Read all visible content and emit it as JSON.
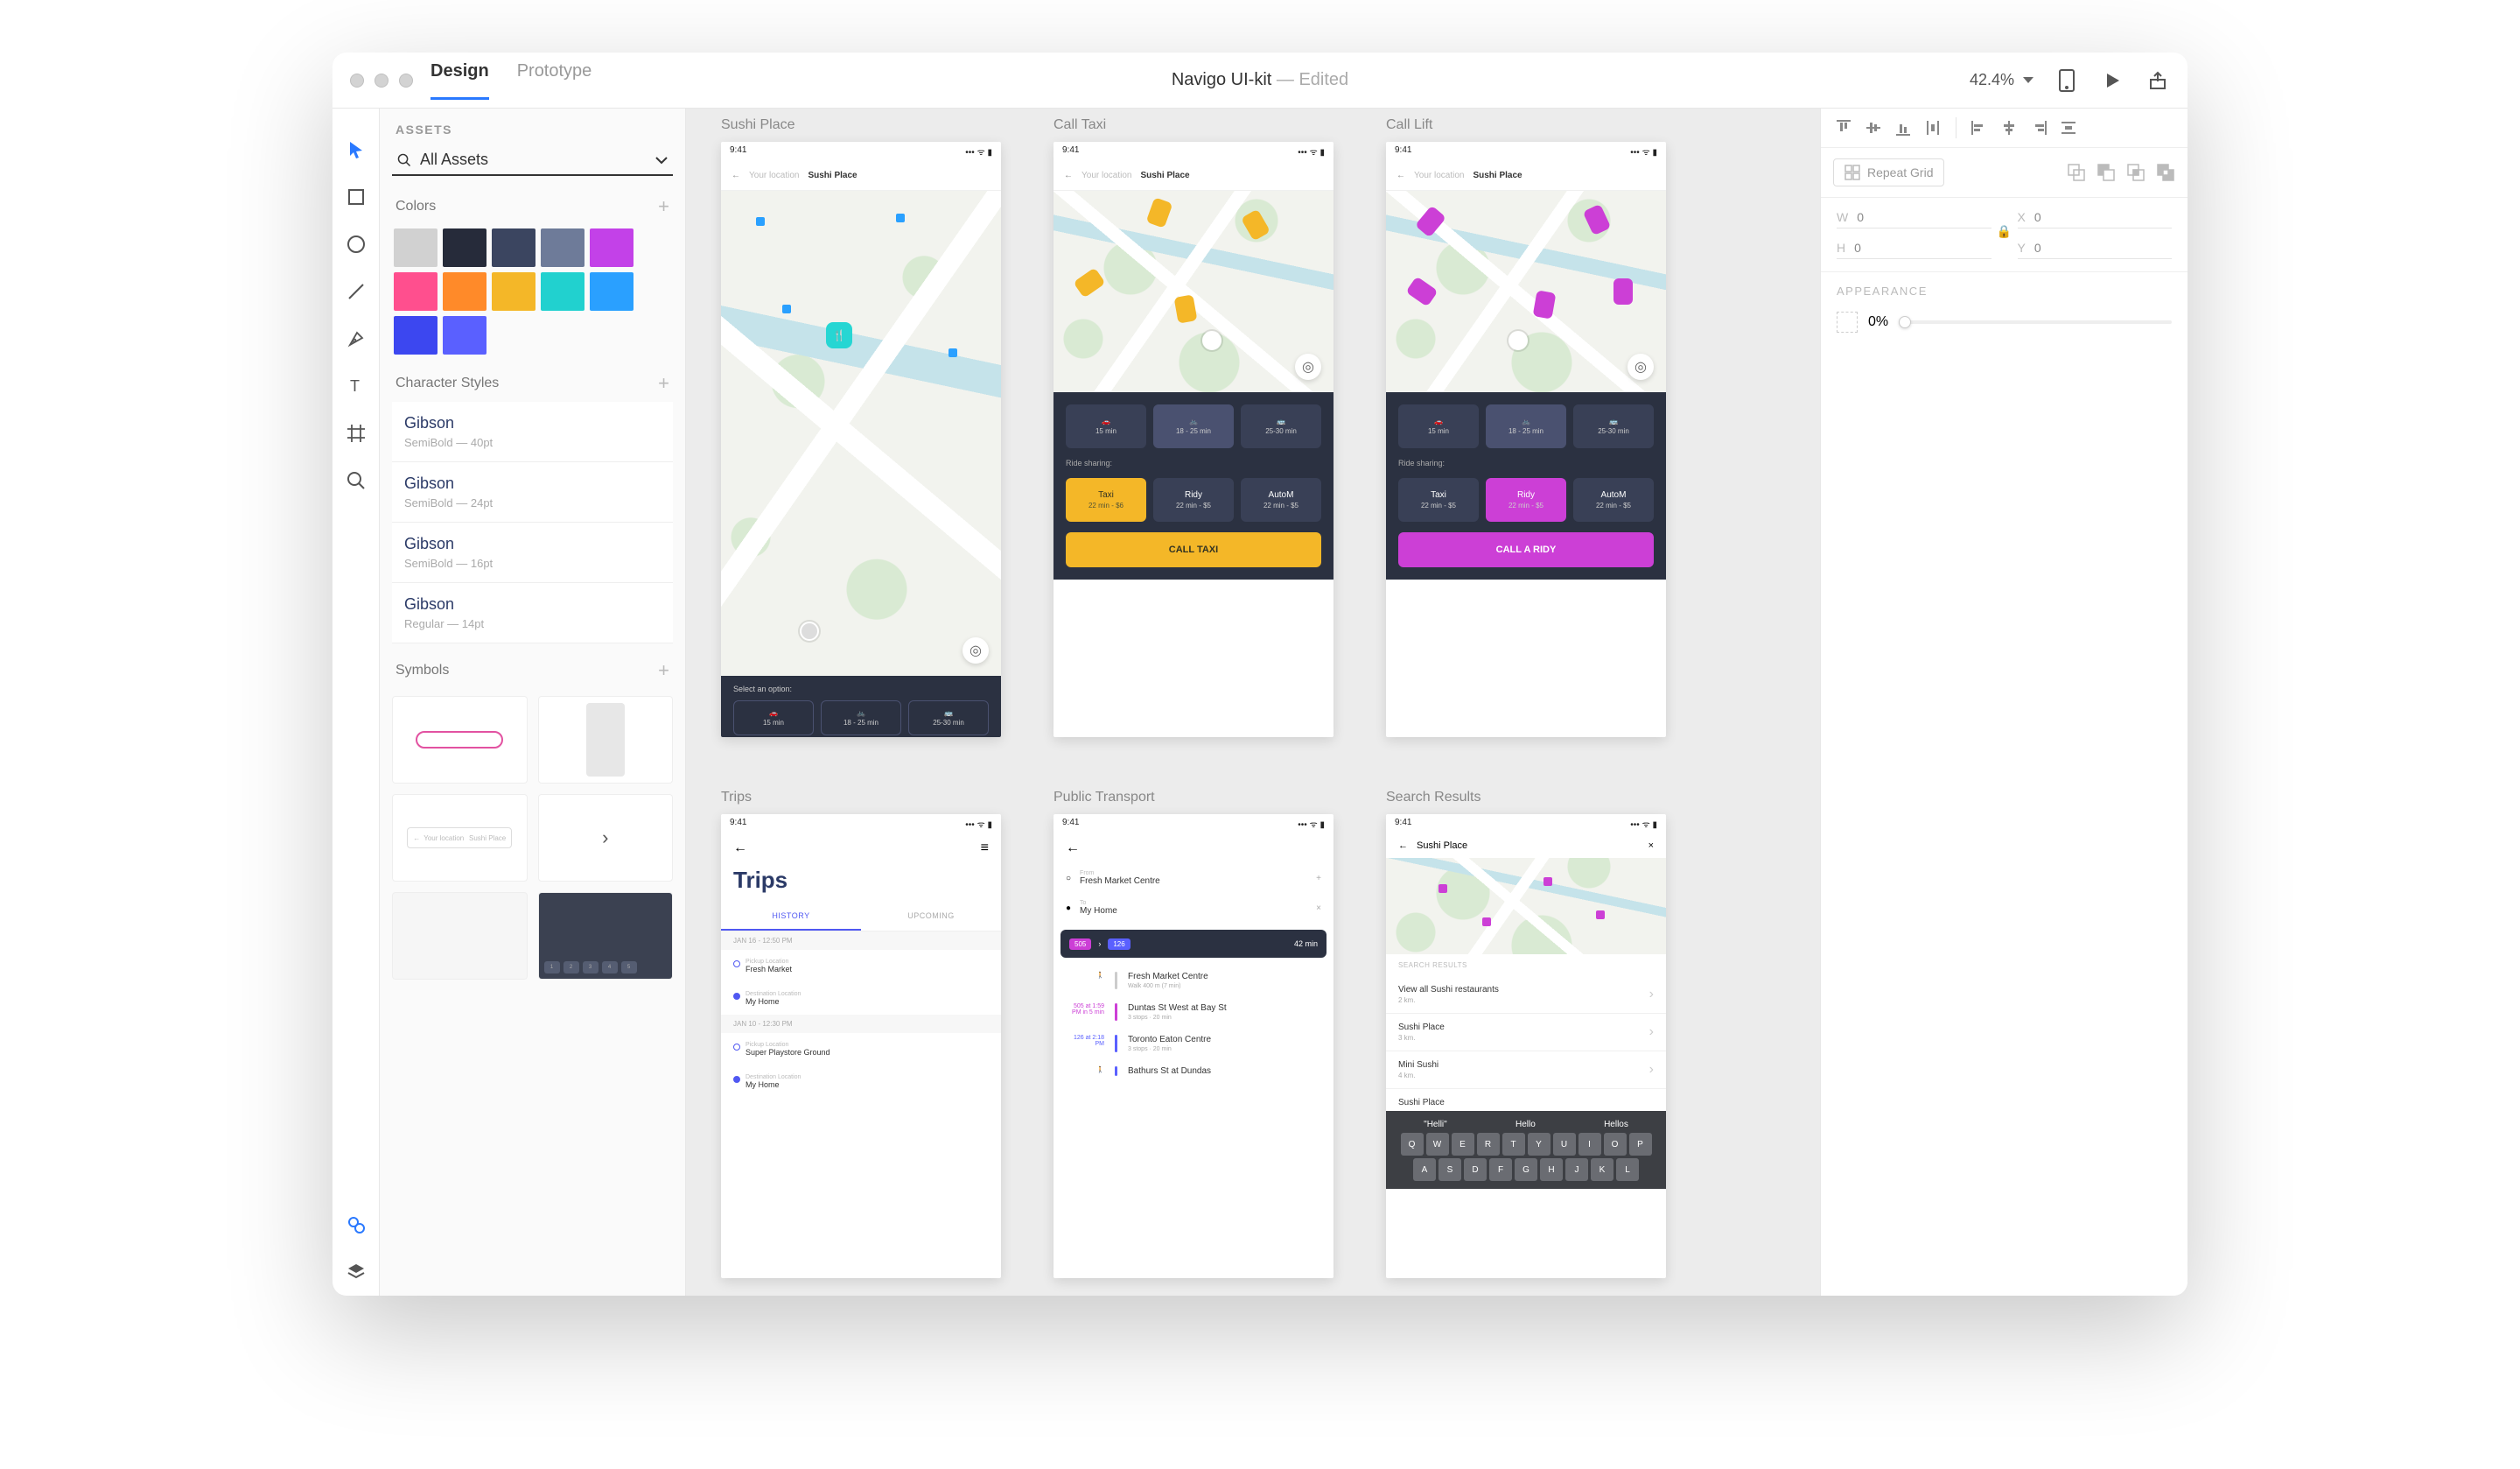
{
  "title": "Navigo UI-kit",
  "edited_suffix": "  —  Edited",
  "tabs": {
    "design": "Design",
    "prototype": "Prototype"
  },
  "zoom": "42.4%",
  "left_panel": {
    "assets_label": "ASSETS",
    "all_assets": "All Assets",
    "colors_label": "Colors",
    "colors": [
      "#d1d1d1",
      "#262b3a",
      "#3b4560",
      "#6e7b99",
      "#c341e8",
      "#ff4f8e",
      "#ff8a29",
      "#f4b728",
      "#21d1cf",
      "#2aa0ff",
      "#3c47f0",
      "#5a60ff"
    ],
    "char_label": "Character Styles",
    "styles": [
      {
        "name": "Gibson",
        "sub": "SemiBold — 40pt"
      },
      {
        "name": "Gibson",
        "sub": "SemiBold — 24pt"
      },
      {
        "name": "Gibson",
        "sub": "SemiBold — 16pt"
      },
      {
        "name": "Gibson",
        "sub": "Regular — 14pt"
      }
    ],
    "symbols_label": "Symbols"
  },
  "artboards": {
    "sushi": {
      "title": "Sushi Place",
      "time": "9:41",
      "from": "Your location",
      "to": "Sushi Place",
      "select": "Select an option:",
      "opts": [
        {
          "n": "",
          "t": "15 min"
        },
        {
          "n": "",
          "t": "18 - 25 min"
        },
        {
          "n": "",
          "t": "25-30 min"
        }
      ]
    },
    "taxi": {
      "title": "Call Taxi",
      "time": "9:41",
      "from": "Your location",
      "to": "Sushi Place",
      "rideshare": "Ride sharing:",
      "modes": [
        {
          "t": "15 min"
        },
        {
          "t": "18 - 25 min"
        },
        {
          "t": "25-30 min"
        }
      ],
      "opts": [
        {
          "n": "Taxi",
          "t": "22 min - $6"
        },
        {
          "n": "Ridy",
          "t": "22 min - $5"
        },
        {
          "n": "AutoM",
          "t": "22 min - $5"
        }
      ],
      "cta": "CALL TAXI"
    },
    "lift": {
      "title": "Call Lift",
      "time": "9:41",
      "from": "Your location",
      "to": "Sushi Place",
      "rideshare": "Ride sharing:",
      "modes": [
        {
          "t": "15 min"
        },
        {
          "t": "18 - 25 min"
        },
        {
          "t": "25-30 min"
        }
      ],
      "opts": [
        {
          "n": "Taxi",
          "t": "22 min - $5"
        },
        {
          "n": "Ridy",
          "t": "22 min - $5"
        },
        {
          "n": "AutoM",
          "t": "22 min - $5"
        }
      ],
      "cta": "CALL A RIDY"
    },
    "trips": {
      "title": "Trips",
      "time": "9:41",
      "heading": "Trips",
      "tab_history": "HISTORY",
      "tab_upcoming": "UPCOMING",
      "d1": "JAN 16 - 12:50 PM",
      "t1_lbl": "Pickup Location",
      "t1": "Fresh Market",
      "t2_lbl": "Destination Location",
      "t2": "My Home",
      "d2": "JAN 10 - 12:30 PM",
      "t3_lbl": "Pickup Location",
      "t3": "Super Playstore Ground",
      "t4_lbl": "Destination Location",
      "t4": "My Home"
    },
    "pt": {
      "title": "Public Transport",
      "time": "9:41",
      "from_lbl": "From",
      "from": "Fresh Market Centre",
      "to_lbl": "To",
      "to": "My Home",
      "b1": "505",
      "b2": "126",
      "total": "42 min",
      "steps": [
        {
          "left": "",
          "line": "#999",
          "main": "Fresh Market Centre",
          "sub": "Walk 400 m (7 min)"
        },
        {
          "left": "505\nat 1:59 PM\nin 5 min",
          "line": "#c341e8",
          "main": "Duntas St West at Bay St",
          "sub": "3 stops · 20 min"
        },
        {
          "left": "126\nat 2:18 PM",
          "line": "#5a60ff",
          "main": "Toronto Eaton Centre",
          "sub": "3 stops · 20 min"
        },
        {
          "left": "",
          "line": "#5a60ff",
          "main": "Bathurs St at Dundas",
          "sub": ""
        }
      ]
    },
    "sr": {
      "title": "Search Results",
      "time": "9:41",
      "query": "Sushi Place",
      "label": "SEARCH RESULTS",
      "items": [
        {
          "m": "View all Sushi restaurants",
          "s": "2 km."
        },
        {
          "m": "Sushi Place",
          "s": "3 km."
        },
        {
          "m": "Mini Sushi",
          "s": "4 km."
        },
        {
          "m": "Sushi Place",
          "s": ""
        }
      ],
      "sugg": [
        "\"Helli\"",
        "Hello",
        "Hellos"
      ],
      "row1": [
        "Q",
        "W",
        "E",
        "R",
        "T",
        "Y",
        "U",
        "I",
        "O",
        "P"
      ],
      "row2": [
        "A",
        "S",
        "D",
        "F",
        "G",
        "H",
        "J",
        "K",
        "L"
      ]
    }
  },
  "right_panel": {
    "repeat": "Repeat Grid",
    "w_lbl": "W",
    "w": "0",
    "x_lbl": "X",
    "x": "0",
    "h_lbl": "H",
    "h": "0",
    "y_lbl": "Y",
    "y": "0",
    "appearance": "APPEARANCE",
    "opacity": "0%"
  }
}
